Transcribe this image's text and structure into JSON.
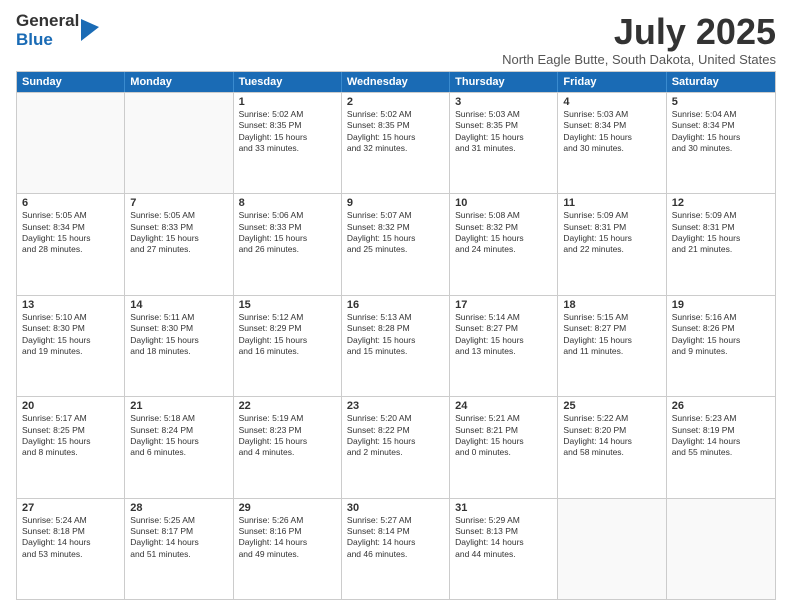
{
  "logo": {
    "general": "General",
    "blue": "Blue"
  },
  "header": {
    "month": "July 2025",
    "location": "North Eagle Butte, South Dakota, United States"
  },
  "weekdays": [
    "Sunday",
    "Monday",
    "Tuesday",
    "Wednesday",
    "Thursday",
    "Friday",
    "Saturday"
  ],
  "rows": [
    [
      {
        "day": "",
        "text": ""
      },
      {
        "day": "",
        "text": ""
      },
      {
        "day": "1",
        "text": "Sunrise: 5:02 AM\nSunset: 8:35 PM\nDaylight: 15 hours\nand 33 minutes."
      },
      {
        "day": "2",
        "text": "Sunrise: 5:02 AM\nSunset: 8:35 PM\nDaylight: 15 hours\nand 32 minutes."
      },
      {
        "day": "3",
        "text": "Sunrise: 5:03 AM\nSunset: 8:35 PM\nDaylight: 15 hours\nand 31 minutes."
      },
      {
        "day": "4",
        "text": "Sunrise: 5:03 AM\nSunset: 8:34 PM\nDaylight: 15 hours\nand 30 minutes."
      },
      {
        "day": "5",
        "text": "Sunrise: 5:04 AM\nSunset: 8:34 PM\nDaylight: 15 hours\nand 30 minutes."
      }
    ],
    [
      {
        "day": "6",
        "text": "Sunrise: 5:05 AM\nSunset: 8:34 PM\nDaylight: 15 hours\nand 28 minutes."
      },
      {
        "day": "7",
        "text": "Sunrise: 5:05 AM\nSunset: 8:33 PM\nDaylight: 15 hours\nand 27 minutes."
      },
      {
        "day": "8",
        "text": "Sunrise: 5:06 AM\nSunset: 8:33 PM\nDaylight: 15 hours\nand 26 minutes."
      },
      {
        "day": "9",
        "text": "Sunrise: 5:07 AM\nSunset: 8:32 PM\nDaylight: 15 hours\nand 25 minutes."
      },
      {
        "day": "10",
        "text": "Sunrise: 5:08 AM\nSunset: 8:32 PM\nDaylight: 15 hours\nand 24 minutes."
      },
      {
        "day": "11",
        "text": "Sunrise: 5:09 AM\nSunset: 8:31 PM\nDaylight: 15 hours\nand 22 minutes."
      },
      {
        "day": "12",
        "text": "Sunrise: 5:09 AM\nSunset: 8:31 PM\nDaylight: 15 hours\nand 21 minutes."
      }
    ],
    [
      {
        "day": "13",
        "text": "Sunrise: 5:10 AM\nSunset: 8:30 PM\nDaylight: 15 hours\nand 19 minutes."
      },
      {
        "day": "14",
        "text": "Sunrise: 5:11 AM\nSunset: 8:30 PM\nDaylight: 15 hours\nand 18 minutes."
      },
      {
        "day": "15",
        "text": "Sunrise: 5:12 AM\nSunset: 8:29 PM\nDaylight: 15 hours\nand 16 minutes."
      },
      {
        "day": "16",
        "text": "Sunrise: 5:13 AM\nSunset: 8:28 PM\nDaylight: 15 hours\nand 15 minutes."
      },
      {
        "day": "17",
        "text": "Sunrise: 5:14 AM\nSunset: 8:27 PM\nDaylight: 15 hours\nand 13 minutes."
      },
      {
        "day": "18",
        "text": "Sunrise: 5:15 AM\nSunset: 8:27 PM\nDaylight: 15 hours\nand 11 minutes."
      },
      {
        "day": "19",
        "text": "Sunrise: 5:16 AM\nSunset: 8:26 PM\nDaylight: 15 hours\nand 9 minutes."
      }
    ],
    [
      {
        "day": "20",
        "text": "Sunrise: 5:17 AM\nSunset: 8:25 PM\nDaylight: 15 hours\nand 8 minutes."
      },
      {
        "day": "21",
        "text": "Sunrise: 5:18 AM\nSunset: 8:24 PM\nDaylight: 15 hours\nand 6 minutes."
      },
      {
        "day": "22",
        "text": "Sunrise: 5:19 AM\nSunset: 8:23 PM\nDaylight: 15 hours\nand 4 minutes."
      },
      {
        "day": "23",
        "text": "Sunrise: 5:20 AM\nSunset: 8:22 PM\nDaylight: 15 hours\nand 2 minutes."
      },
      {
        "day": "24",
        "text": "Sunrise: 5:21 AM\nSunset: 8:21 PM\nDaylight: 15 hours\nand 0 minutes."
      },
      {
        "day": "25",
        "text": "Sunrise: 5:22 AM\nSunset: 8:20 PM\nDaylight: 14 hours\nand 58 minutes."
      },
      {
        "day": "26",
        "text": "Sunrise: 5:23 AM\nSunset: 8:19 PM\nDaylight: 14 hours\nand 55 minutes."
      }
    ],
    [
      {
        "day": "27",
        "text": "Sunrise: 5:24 AM\nSunset: 8:18 PM\nDaylight: 14 hours\nand 53 minutes."
      },
      {
        "day": "28",
        "text": "Sunrise: 5:25 AM\nSunset: 8:17 PM\nDaylight: 14 hours\nand 51 minutes."
      },
      {
        "day": "29",
        "text": "Sunrise: 5:26 AM\nSunset: 8:16 PM\nDaylight: 14 hours\nand 49 minutes."
      },
      {
        "day": "30",
        "text": "Sunrise: 5:27 AM\nSunset: 8:14 PM\nDaylight: 14 hours\nand 46 minutes."
      },
      {
        "day": "31",
        "text": "Sunrise: 5:29 AM\nSunset: 8:13 PM\nDaylight: 14 hours\nand 44 minutes."
      },
      {
        "day": "",
        "text": ""
      },
      {
        "day": "",
        "text": ""
      }
    ]
  ]
}
